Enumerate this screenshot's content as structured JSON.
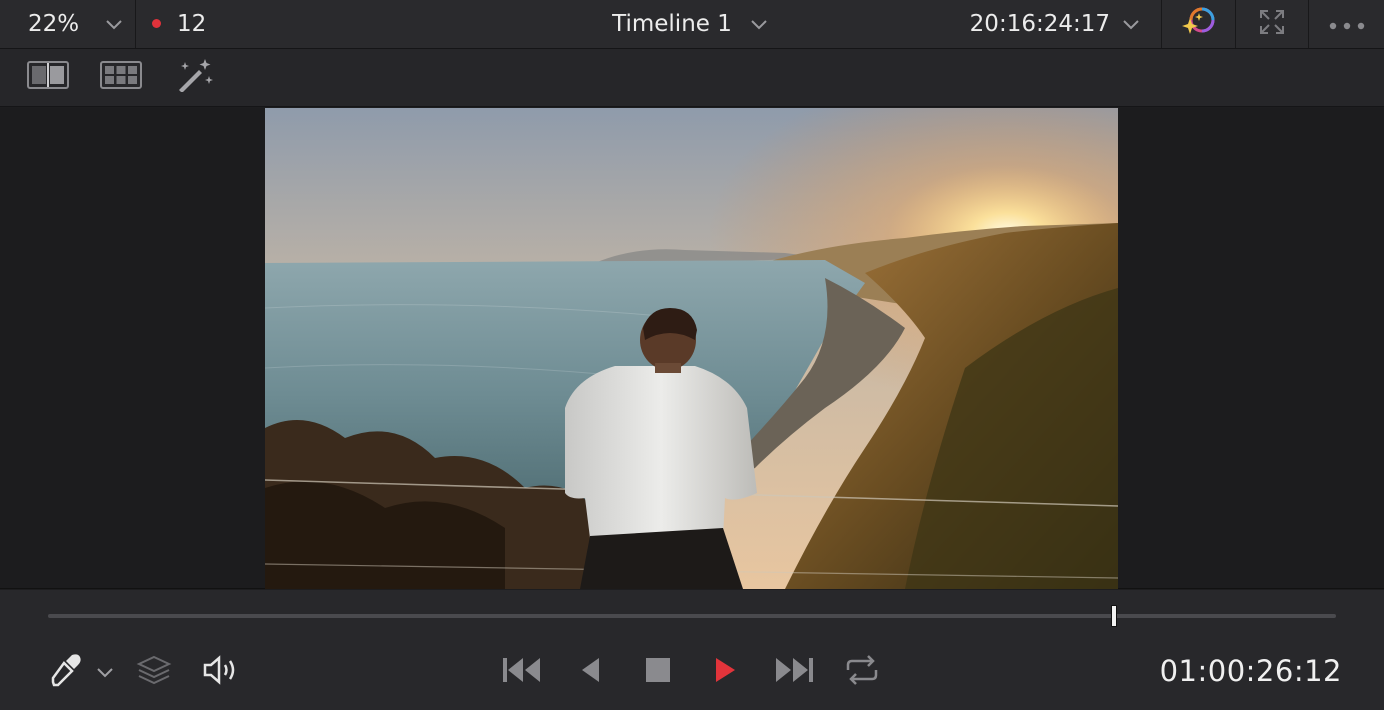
{
  "topbar": {
    "zoom": "22%",
    "clip_count": "12",
    "timeline_name": "Timeline 1",
    "source_timecode": "20:16:24:17"
  },
  "icons": {
    "zoom_dropdown": "chevron-down-icon",
    "timeline_dropdown": "chevron-down-icon",
    "timecode_dropdown": "chevron-down-icon",
    "color_effects": "sparkle-color-wheel-icon",
    "fullscreen": "expand-arrows-icon",
    "more_options": "ellipsis-icon",
    "split_view": "split-screen-icon",
    "grid_view": "grid-layout-icon",
    "magic_wand": "magic-wand-icon",
    "eyedropper": "eyedropper-icon",
    "layers": "layers-icon",
    "audio": "speaker-icon",
    "jump_start": "skip-to-start-icon",
    "reverse": "play-reverse-icon",
    "stop": "stop-icon",
    "play": "play-icon",
    "jump_end": "skip-to-end-icon",
    "loop": "loop-icon"
  },
  "colors": {
    "record_dot": "#e0323b",
    "play_button": "#e2343b",
    "background": "#1d1d1f"
  },
  "scrubber": {
    "position": 0.828
  },
  "transport": {
    "timecode": "01:00:26:12"
  }
}
